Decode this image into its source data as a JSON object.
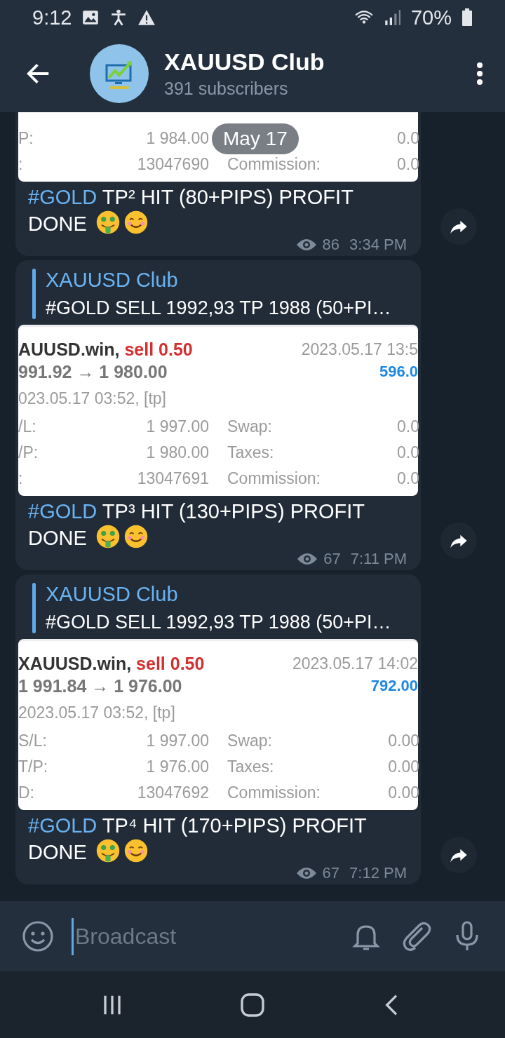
{
  "status_bar": {
    "time": "9:12",
    "battery": "70%"
  },
  "header": {
    "title": "XAUUSD Club",
    "subtitle": "391 subscribers"
  },
  "date_pill": "May 17",
  "messages": [
    {
      "trade": {
        "rows": [
          {
            "label": "P:",
            "value": "1 984.00",
            "value2": "0.0"
          },
          {
            "label": ":",
            "value": "13047690",
            "label2": "Commission:",
            "value2": "0.0"
          }
        ]
      },
      "caption": {
        "tag": "#GOLD",
        "text": " TP² HIT (80+PIPS) PROFIT DONE"
      },
      "views": "86",
      "time": "3:34 PM"
    },
    {
      "forward": {
        "name": "XAUUSD Club",
        "text": "#GOLD SELL 1992,93 TP 1988 (50+PI…"
      },
      "trade": {
        "symbol": "AUUSD.win,",
        "side": "sell 0.50",
        "closed": "2023.05.17 13:5",
        "price": "991.92 → 1 980.00",
        "profit": "596.0",
        "opened": "023.05.17 03:52, [tp]",
        "rows": [
          {
            "label": "/L:",
            "value": "1 997.00",
            "label2": "Swap:",
            "value2": "0.0"
          },
          {
            "label": "/P:",
            "value": "1 980.00",
            "label2": "Taxes:",
            "value2": "0.0"
          },
          {
            "label": ":",
            "value": "13047691",
            "label2": "Commission:",
            "value2": "0.0"
          }
        ]
      },
      "caption": {
        "tag": "#GOLD",
        "text": " TP³ HIT (130+PIPS) PROFIT DONE"
      },
      "views": "67",
      "time": "7:11 PM"
    },
    {
      "forward": {
        "name": "XAUUSD Club",
        "text": "#GOLD SELL 1992,93 TP 1988 (50+PI…"
      },
      "trade": {
        "symbol": "XAUUSD.win,",
        "side": "sell 0.50",
        "closed": "2023.05.17 14:02",
        "price": "1 991.84 → 1 976.00",
        "profit": "792.00",
        "opened": "2023.05.17 03:52, [tp]",
        "rows": [
          {
            "label": "S/L:",
            "value": "1 997.00",
            "label2": "Swap:",
            "value2": "0.00"
          },
          {
            "label": "T/P:",
            "value": "1 976.00",
            "label2": "Taxes:",
            "value2": "0.00"
          },
          {
            "label": "D:",
            "value": "13047692",
            "label2": "Commission:",
            "value2": "0.00"
          }
        ]
      },
      "caption": {
        "tag": "#GOLD",
        "text": " TP⁴ HIT (170+PIPS) PROFIT DONE"
      },
      "views": "67",
      "time": "7:12 PM"
    }
  ],
  "input": {
    "placeholder": "Broadcast"
  }
}
